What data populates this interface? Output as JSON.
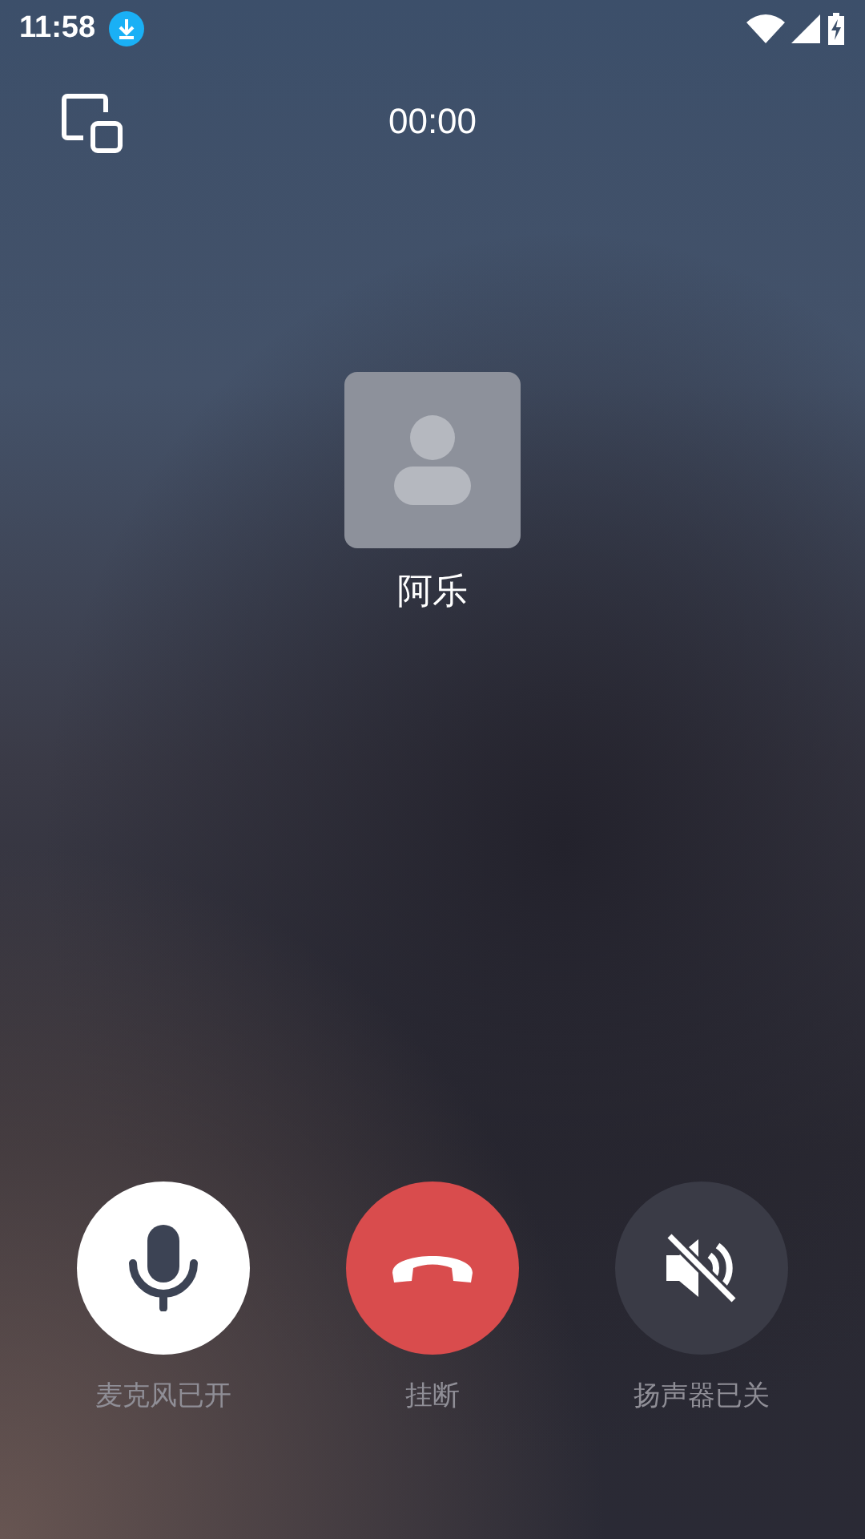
{
  "status_bar": {
    "time": "11:58"
  },
  "call": {
    "timer": "00:00",
    "contact_name": "阿乐"
  },
  "controls": [
    {
      "kind": "mic",
      "label": "麦克风已开",
      "on": true
    },
    {
      "kind": "hangup",
      "label": "挂断"
    },
    {
      "kind": "speaker",
      "label": "扬声器已关",
      "on": false
    }
  ]
}
